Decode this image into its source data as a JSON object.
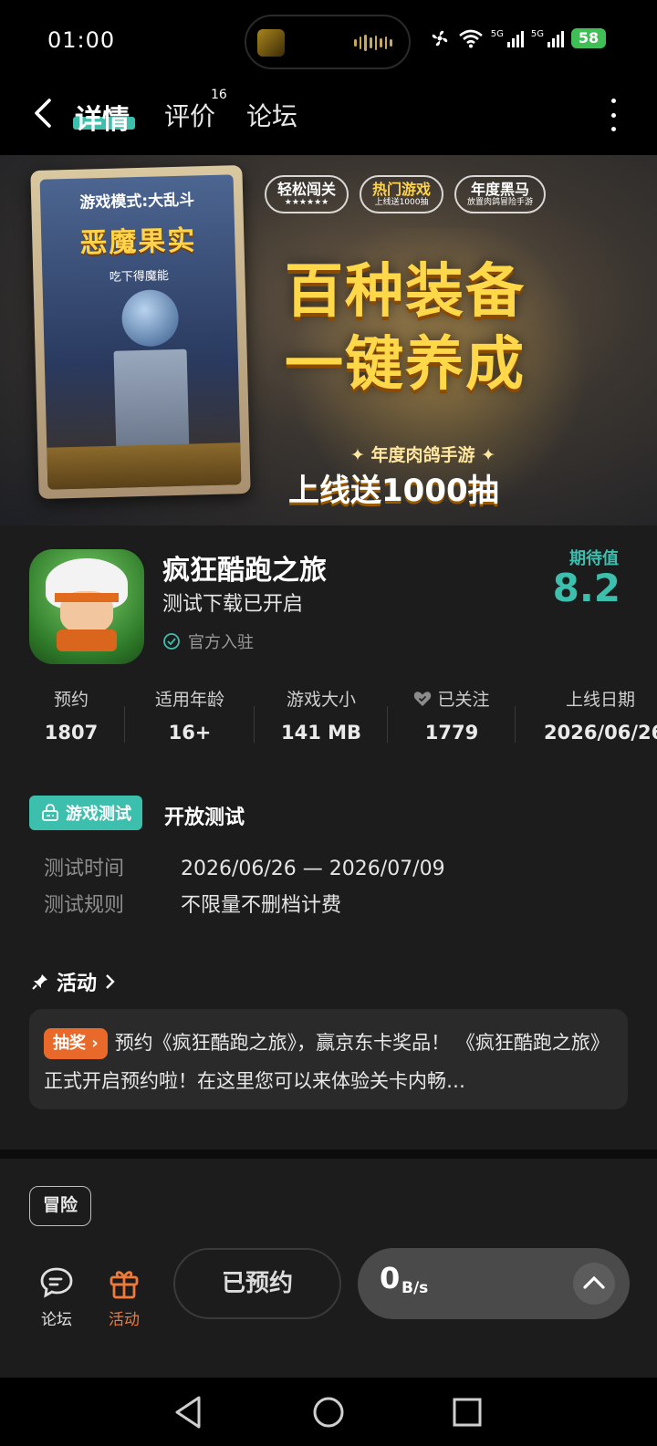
{
  "status_bar": {
    "time": "01:00",
    "network_1": "5G",
    "network_2": "5G",
    "battery": "58"
  },
  "header": {
    "tabs": [
      {
        "label": "详情"
      },
      {
        "label": "评价"
      },
      {
        "label": "论坛"
      }
    ],
    "review_count": "16"
  },
  "banner": {
    "card_mode": "游戏模式:大乱斗",
    "card_title": "恶魔果实",
    "card_subtitle": "吃下得魔能",
    "badges": [
      {
        "main": "轻松闯关",
        "sub": "★★★★★★"
      },
      {
        "main": "热门游戏",
        "sub": "上线送1000抽"
      },
      {
        "main": "年度黑马",
        "sub": "放置肉鸽冒险手游"
      }
    ],
    "headline_line1": "百种装备",
    "headline_line2": "一键养成",
    "sub_line1": "✦ 年度肉鸽手游 ✦",
    "sub_line2": "上线送1000抽"
  },
  "app": {
    "name": "疯狂酷跑之旅",
    "status": "测试下载已开启",
    "official": "官方入驻",
    "expect_label": "期待值",
    "expect_value": "8.2"
  },
  "stats": [
    {
      "label": "预约",
      "value": "1807"
    },
    {
      "label": "适用年龄",
      "value": "16+"
    },
    {
      "label": "游戏大小",
      "value": "141 MB"
    },
    {
      "label": "已关注",
      "value": "1779"
    },
    {
      "label": "上线日期",
      "value": "2026/06/26"
    }
  ],
  "test": {
    "badge": "游戏测试",
    "title": "开放测试",
    "time_label": "测试时间",
    "time_value": "2026/06/26 — 2026/07/09",
    "rule_label": "测试规则",
    "rule_value": "不限量不删档计费"
  },
  "activity": {
    "heading": "活动",
    "tag": "抽奖",
    "text": "预约《疯狂酷跑之旅》，赢京东卡奖品！ 《疯狂酷跑之旅》正式开启预约啦！在这里您可以来体验关卡内畅…"
  },
  "genre_tag": "冒险",
  "bottom_nav": {
    "forum": "论坛",
    "activity": "活动",
    "reserve": "已预约",
    "speed_value": "0",
    "speed_unit": "B/s"
  },
  "colors": {
    "accent": "#3dbfae",
    "activity_orange": "#e8692a",
    "panel_bg": "#1c1c1c"
  }
}
